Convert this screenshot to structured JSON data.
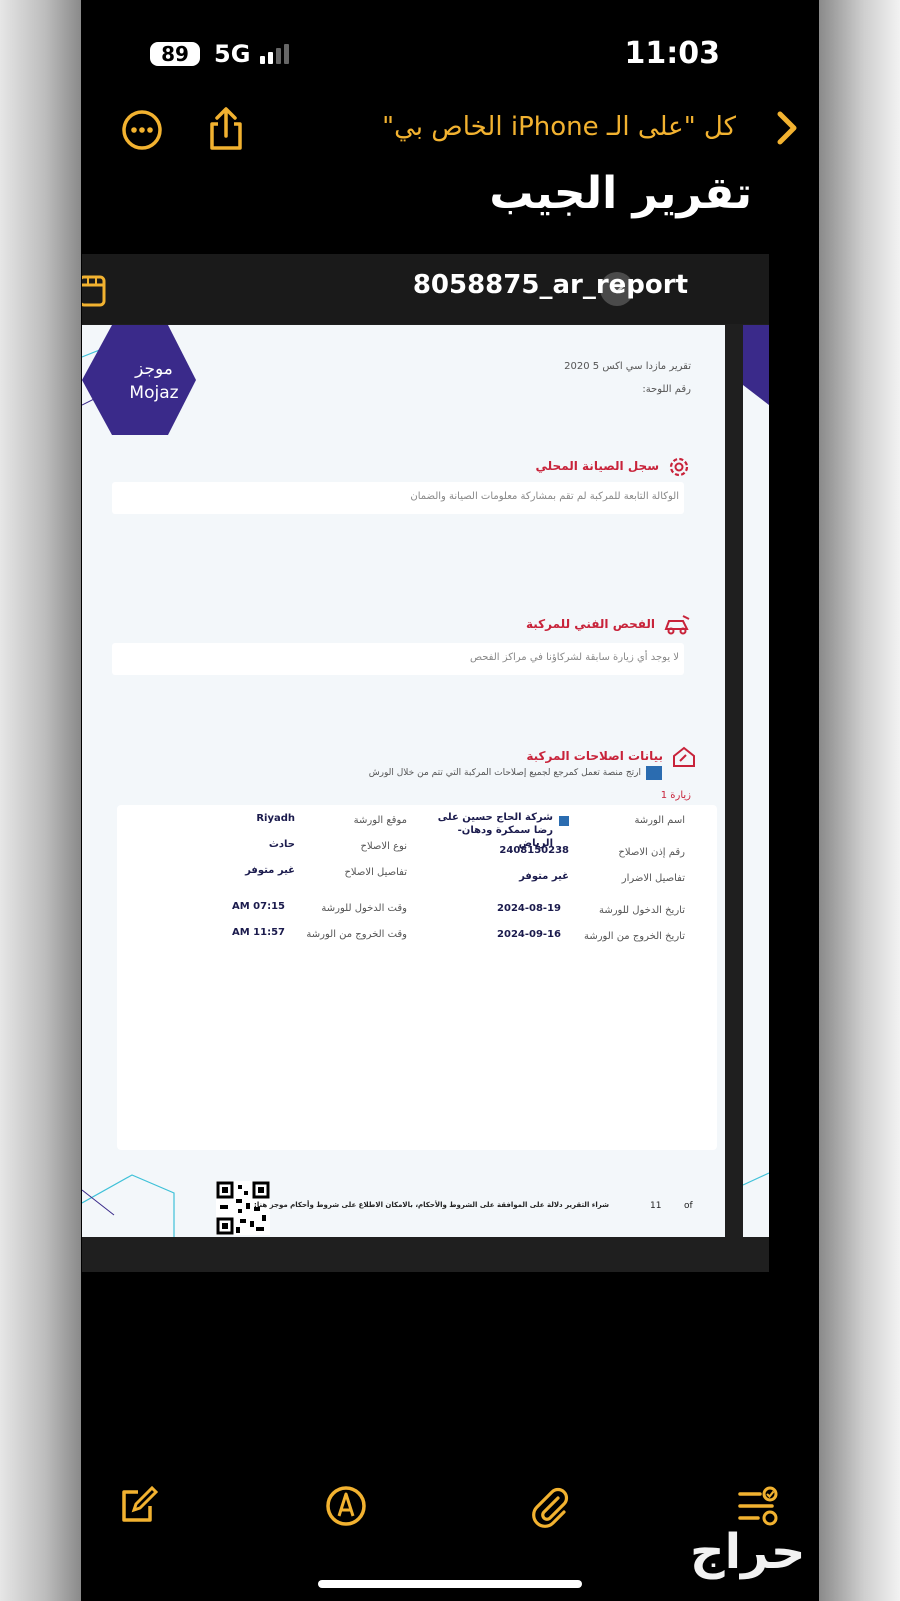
{
  "status_bar": {
    "time": "11:03",
    "battery": "89",
    "network": "5G"
  },
  "nav": {
    "back_label": "كل \"على الـ iPhone الخاص بي\""
  },
  "note": {
    "title": "تقرير الجيب"
  },
  "attachment": {
    "filename": "8058875_ar_report"
  },
  "report": {
    "logo_ar": "موجز",
    "logo_en": "Mojaz",
    "car_title": "تقرير مازدا سي اكس 5 2020",
    "plate_label": "رقم اللوحة:",
    "maintenance": {
      "title": "سجل الصيانة المحلي",
      "message": "الوكالة التابعة للمركبة لم تقم بمشاركة معلومات الصيانة والضمان"
    },
    "inspection": {
      "title": "الفحص الفني للمركبة",
      "message": "لا يوجد أي زيارة سابقة لشركاؤنا في مراكز الفحص"
    },
    "repairs": {
      "title": "بيانات اصلاحات المركبة",
      "subtitle": "ارتج منصة تعمل كمرجع لجميع إصلاحات المركبة التي تتم من خلال الورش",
      "visit_label": "زيارة 1",
      "fields": {
        "workshop_name_label": "اسم الورشة",
        "workshop_name_value": "شركة الحاج حسين على رضا سمكرة ودهان- الرياض",
        "repair_permit_label": "رقم إذن الاصلاح",
        "repair_permit_value": "2408150238",
        "damage_details_label": "تفاصيل الاضرار",
        "damage_details_value": "غير متوفر",
        "entry_date_label": "تاريخ الدخول للورشة",
        "entry_date_value": "2024-08-19",
        "exit_date_label": "تاريخ الخروج من الورشة",
        "exit_date_value": "2024-09-16",
        "workshop_location_label": "موقع الورشة",
        "workshop_location_value": "Riyadh",
        "repair_type_label": "نوع الاصلاح",
        "repair_type_value": "حادث",
        "repair_details_label": "تفاصيل الاصلاح",
        "repair_details_value": "غير متوفر",
        "entry_time_label": "وقت الدخول للورشة",
        "entry_time_value": "07:15 AM",
        "exit_time_label": "وقت الخروج من الورشة",
        "exit_time_value": "11:57 AM"
      }
    },
    "footer": {
      "terms": "شراء التقرير دلالة على الموافقة على الشروط والأحكام، بالامكان الاطلاع على شروط وأحكام موجز هنا:",
      "page_number": "11",
      "of_label": "of"
    }
  },
  "watermark": "حراج",
  "colors": {
    "accent": "#f2b230",
    "brand_purple": "#3a2a8a",
    "section_red": "#c8233a"
  }
}
